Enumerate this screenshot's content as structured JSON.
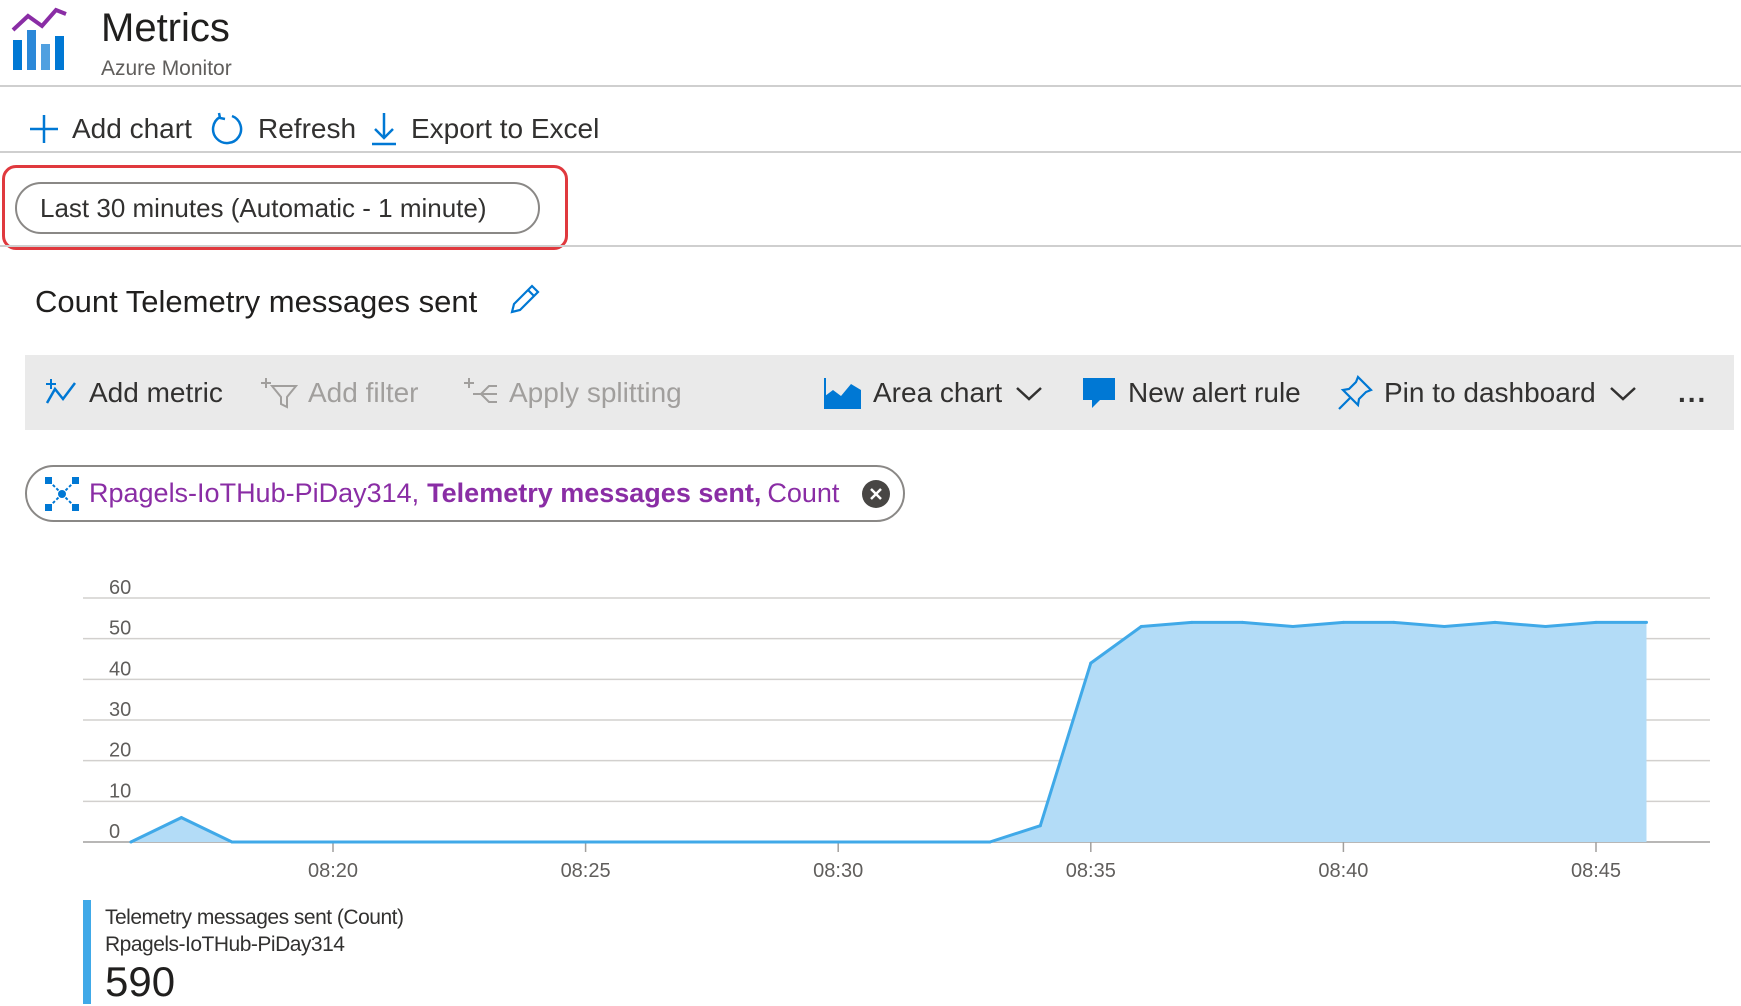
{
  "header": {
    "title": "Metrics",
    "subtitle": "Azure Monitor",
    "logo_icon": "metrics-bar-chart-icon"
  },
  "toolbar": {
    "add_chart": "Add chart",
    "refresh": "Refresh",
    "export": "Export to Excel"
  },
  "time_range": {
    "label": "Last 30 minutes (Automatic - 1 minute)",
    "highlight_color": "#e0393e"
  },
  "chart_title": "Count Telemetry messages sent",
  "chart_toolbar": {
    "add_metric": "Add metric",
    "add_filter": "Add filter",
    "apply_splitting": "Apply splitting",
    "chart_type": "Area chart",
    "new_alert_rule": "New alert rule",
    "pin_to_dashboard": "Pin to dashboard",
    "more": "..."
  },
  "metric_pill": {
    "resource": "Rpagels-IoTHub-PiDay314,",
    "metric": "Telemetry messages sent,",
    "aggregation": "Count",
    "text_color": "#8a2da5"
  },
  "legend": {
    "name": "Telemetry messages sent (Count)",
    "resource": "Rpagels-IoTHub-PiDay314",
    "value": "590",
    "color": "#40a9e8"
  },
  "chart_data": {
    "type": "area",
    "title": "Count Telemetry messages sent",
    "xlabel": "",
    "ylabel": "",
    "ylim": [
      0,
      60
    ],
    "yticks": [
      "0",
      "10",
      "20",
      "30",
      "40",
      "50",
      "60"
    ],
    "xticks": [
      "08:20",
      "08:25",
      "08:30",
      "08:35",
      "08:40",
      "08:45"
    ],
    "x_minutes": [
      16,
      17,
      18,
      19,
      20,
      21,
      22,
      23,
      24,
      25,
      26,
      27,
      28,
      29,
      30,
      31,
      32,
      33,
      34,
      35,
      36,
      37,
      38,
      39,
      40,
      41,
      42,
      43,
      44,
      45,
      46
    ],
    "series": [
      {
        "name": "Telemetry messages sent (Count)",
        "color": "#40a9e8",
        "fill": "#b3dcf7",
        "values": [
          0,
          6,
          0,
          0,
          0,
          0,
          0,
          0,
          0,
          0,
          0,
          0,
          0,
          0,
          0,
          0,
          0,
          0,
          4,
          44,
          53,
          54,
          54,
          53,
          54,
          54,
          53,
          54,
          53,
          54,
          54
        ]
      }
    ],
    "grid": true
  }
}
